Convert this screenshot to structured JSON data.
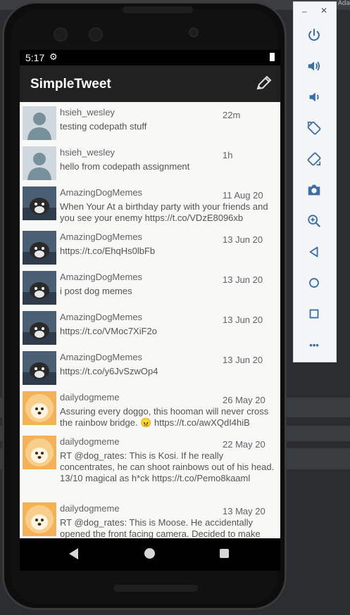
{
  "ide": {
    "corner_text": "Ada"
  },
  "status": {
    "time": "5:17",
    "gear": "⚙"
  },
  "app": {
    "title": "SimpleTweet"
  },
  "tweets": [
    {
      "handle": "hsieh_wesley",
      "time": "22m",
      "text": "testing codepath stuff",
      "avatar": "person"
    },
    {
      "handle": "hsieh_wesley",
      "time": "1h",
      "text": "hello from codepath assignment",
      "avatar": "person"
    },
    {
      "handle": "AmazingDogMemes",
      "time": "11 Aug 20",
      "text": "When Your At a birthday party with your friends and you see your enemy https://t.co/VDzE8096xb",
      "avatar": "dog"
    },
    {
      "handle": "AmazingDogMemes",
      "time": "13 Jun 20",
      "text": "https://t.co/EhqHs0lbFb",
      "avatar": "dog"
    },
    {
      "handle": "AmazingDogMemes",
      "time": "13 Jun 20",
      "text": "i post dog memes",
      "avatar": "dog"
    },
    {
      "handle": "AmazingDogMemes",
      "time": "13 Jun 20",
      "text": "https://t.co/VMoc7XiF2o",
      "avatar": "dog"
    },
    {
      "handle": "AmazingDogMemes",
      "time": "13 Jun 20",
      "text": "https://t.co/y6JvSzwOp4",
      "avatar": "dog"
    },
    {
      "handle": "dailydogmeme",
      "time": "26 May 20",
      "text": "Assuring every doggo, this hooman will never cross the rainbow bridge. 😠 https://t.co/awXQdI4hiB",
      "avatar": "puppy"
    },
    {
      "handle": "dailydogmeme",
      "time": "22 May 20",
      "text": "RT @dog_rates: This is Kosi. If he really concentrates, he can shoot rainbows out of his head. 13/10 magical as h*ck https://t.co/Pemo8kaaml",
      "avatar": "puppy"
    },
    {
      "handle": "dailydogmeme",
      "time": "13 May 20",
      "text": "RT @dog_rates: This is Moose. He accidentally opened the front facing camera. Decided to make",
      "avatar": "puppy"
    }
  ],
  "panel": {
    "min": "–",
    "close": "✕",
    "more": "•••",
    "buttons": [
      "power-icon",
      "volume-up-icon",
      "volume-down-icon",
      "rotate-left-icon",
      "rotate-right-icon",
      "camera-icon",
      "zoom-icon",
      "back-icon",
      "home-icon",
      "overview-icon",
      "more-icon"
    ]
  }
}
